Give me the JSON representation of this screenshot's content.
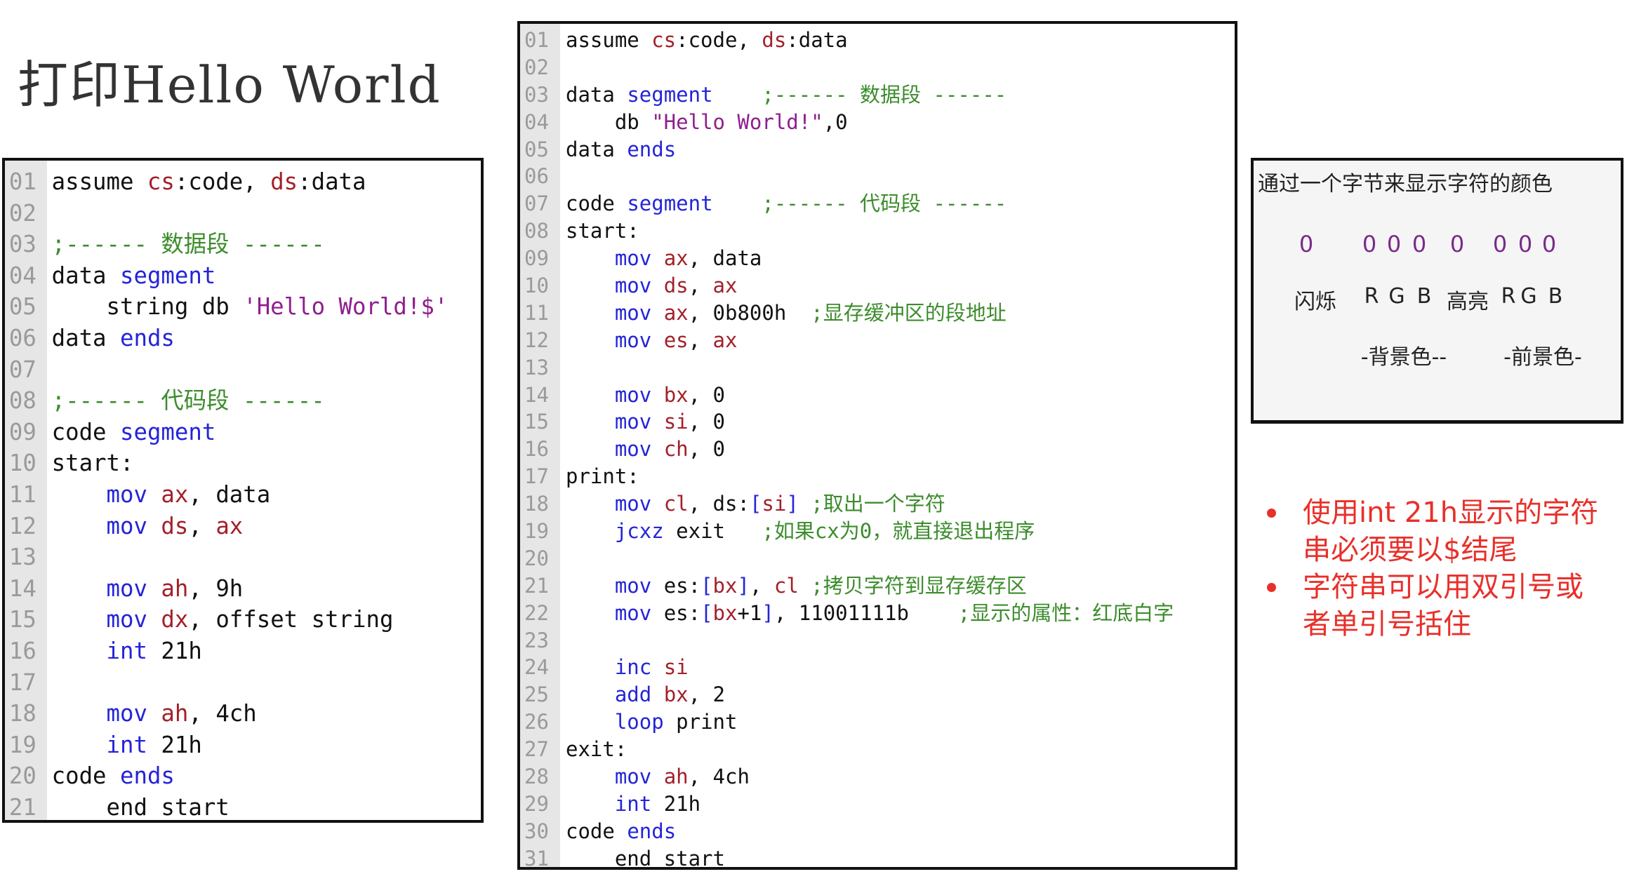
{
  "title": "打印Hello World",
  "colors": {
    "keyword": "#2424d8",
    "register": "#a3202a",
    "string": "#8e1f8e",
    "comment": "#3c8c2c",
    "note": "#e8302a",
    "bit": "#7a2a8a"
  },
  "left_code": [
    [
      [
        "assume ",
        "p"
      ],
      [
        "cs",
        "r"
      ],
      [
        ":code, ",
        "p"
      ],
      [
        "ds",
        "r"
      ],
      [
        ":data",
        "p"
      ]
    ],
    [],
    [
      [
        ";------ 数据段 ------",
        "c"
      ]
    ],
    [
      [
        "data ",
        "p"
      ],
      [
        "segment",
        "k"
      ]
    ],
    [
      [
        "    string db ",
        "p"
      ],
      [
        "'Hello World!$'",
        "s"
      ]
    ],
    [
      [
        "data ",
        "p"
      ],
      [
        "ends",
        "k"
      ]
    ],
    [],
    [
      [
        ";------ 代码段 ------",
        "c"
      ]
    ],
    [
      [
        "code ",
        "p"
      ],
      [
        "segment",
        "k"
      ]
    ],
    [
      [
        "start:",
        "p"
      ]
    ],
    [
      [
        "    ",
        "p"
      ],
      [
        "mov",
        "k"
      ],
      [
        " ",
        "p"
      ],
      [
        "ax",
        "r"
      ],
      [
        ", data",
        "p"
      ]
    ],
    [
      [
        "    ",
        "p"
      ],
      [
        "mov",
        "k"
      ],
      [
        " ",
        "p"
      ],
      [
        "ds",
        "r"
      ],
      [
        ", ",
        "p"
      ],
      [
        "ax",
        "r"
      ]
    ],
    [],
    [
      [
        "    ",
        "p"
      ],
      [
        "mov",
        "k"
      ],
      [
        " ",
        "p"
      ],
      [
        "ah",
        "r"
      ],
      [
        ", 9h",
        "p"
      ]
    ],
    [
      [
        "    ",
        "p"
      ],
      [
        "mov",
        "k"
      ],
      [
        " ",
        "p"
      ],
      [
        "dx",
        "r"
      ],
      [
        ", offset string",
        "p"
      ]
    ],
    [
      [
        "    ",
        "p"
      ],
      [
        "int",
        "k"
      ],
      [
        " 21h",
        "p"
      ]
    ],
    [],
    [
      [
        "    ",
        "p"
      ],
      [
        "mov",
        "k"
      ],
      [
        " ",
        "p"
      ],
      [
        "ah",
        "r"
      ],
      [
        ", 4ch",
        "p"
      ]
    ],
    [
      [
        "    ",
        "p"
      ],
      [
        "int",
        "k"
      ],
      [
        " 21h",
        "p"
      ]
    ],
    [
      [
        "code ",
        "p"
      ],
      [
        "ends",
        "k"
      ]
    ],
    [
      [
        "    end start",
        "p"
      ]
    ]
  ],
  "mid_code": [
    [
      [
        "assume ",
        "p"
      ],
      [
        "cs",
        "r"
      ],
      [
        ":code, ",
        "p"
      ],
      [
        "ds",
        "r"
      ],
      [
        ":data",
        "p"
      ]
    ],
    [],
    [
      [
        "data ",
        "p"
      ],
      [
        "segment",
        "k"
      ],
      [
        "    ;------ 数据段 ------",
        "c"
      ]
    ],
    [
      [
        "    db ",
        "p"
      ],
      [
        "\"Hello World!\"",
        "s"
      ],
      [
        ",0",
        "p"
      ]
    ],
    [
      [
        "data ",
        "p"
      ],
      [
        "ends",
        "k"
      ]
    ],
    [],
    [
      [
        "code ",
        "p"
      ],
      [
        "segment",
        "k"
      ],
      [
        "    ;------ 代码段 ------",
        "c"
      ]
    ],
    [
      [
        "start:",
        "p"
      ]
    ],
    [
      [
        "    ",
        "p"
      ],
      [
        "mov",
        "k"
      ],
      [
        " ",
        "p"
      ],
      [
        "ax",
        "r"
      ],
      [
        ", data",
        "p"
      ]
    ],
    [
      [
        "    ",
        "p"
      ],
      [
        "mov",
        "k"
      ],
      [
        " ",
        "p"
      ],
      [
        "ds",
        "r"
      ],
      [
        ", ",
        "p"
      ],
      [
        "ax",
        "r"
      ]
    ],
    [
      [
        "    ",
        "p"
      ],
      [
        "mov",
        "k"
      ],
      [
        " ",
        "p"
      ],
      [
        "ax",
        "r"
      ],
      [
        ", 0b800h  ",
        "p"
      ],
      [
        ";显存缓冲区的段地址",
        "c"
      ]
    ],
    [
      [
        "    ",
        "p"
      ],
      [
        "mov",
        "k"
      ],
      [
        " ",
        "p"
      ],
      [
        "es",
        "r"
      ],
      [
        ", ",
        "p"
      ],
      [
        "ax",
        "r"
      ]
    ],
    [],
    [
      [
        "    ",
        "p"
      ],
      [
        "mov",
        "k"
      ],
      [
        " ",
        "p"
      ],
      [
        "bx",
        "r"
      ],
      [
        ", 0",
        "p"
      ]
    ],
    [
      [
        "    ",
        "p"
      ],
      [
        "mov",
        "k"
      ],
      [
        " ",
        "p"
      ],
      [
        "si",
        "r"
      ],
      [
        ", 0",
        "p"
      ]
    ],
    [
      [
        "    ",
        "p"
      ],
      [
        "mov",
        "k"
      ],
      [
        " ",
        "p"
      ],
      [
        "ch",
        "r"
      ],
      [
        ", 0",
        "p"
      ]
    ],
    [
      [
        "print:",
        "p"
      ]
    ],
    [
      [
        "    ",
        "p"
      ],
      [
        "mov",
        "k"
      ],
      [
        " ",
        "p"
      ],
      [
        "cl",
        "r"
      ],
      [
        ", ds:",
        "p"
      ],
      [
        "[",
        "k"
      ],
      [
        "si",
        "r"
      ],
      [
        "]",
        "k"
      ],
      [
        " ",
        "p"
      ],
      [
        ";取出一个字符",
        "c"
      ]
    ],
    [
      [
        "    ",
        "p"
      ],
      [
        "jcxz",
        "k"
      ],
      [
        " exit   ",
        "p"
      ],
      [
        ";如果cx为0，就直接退出程序",
        "c"
      ]
    ],
    [],
    [
      [
        "    ",
        "p"
      ],
      [
        "mov",
        "k"
      ],
      [
        " es:",
        "p"
      ],
      [
        "[",
        "k"
      ],
      [
        "bx",
        "r"
      ],
      [
        "]",
        "k"
      ],
      [
        ", ",
        "p"
      ],
      [
        "cl",
        "r"
      ],
      [
        " ",
        "p"
      ],
      [
        ";拷贝字符到显存缓存区",
        "c"
      ]
    ],
    [
      [
        "    ",
        "p"
      ],
      [
        "mov",
        "k"
      ],
      [
        " es:",
        "p"
      ],
      [
        "[",
        "k"
      ],
      [
        "bx",
        "r"
      ],
      [
        "+1",
        "p"
      ],
      [
        "]",
        "k"
      ],
      [
        ", 11001111b    ",
        "p"
      ],
      [
        ";显示的属性：红底白字",
        "c"
      ]
    ],
    [],
    [
      [
        "    ",
        "p"
      ],
      [
        "inc",
        "k"
      ],
      [
        " ",
        "p"
      ],
      [
        "si",
        "r"
      ]
    ],
    [
      [
        "    ",
        "p"
      ],
      [
        "add",
        "k"
      ],
      [
        " ",
        "p"
      ],
      [
        "bx",
        "r"
      ],
      [
        ", 2",
        "p"
      ]
    ],
    [
      [
        "    ",
        "p"
      ],
      [
        "loop",
        "k"
      ],
      [
        " print",
        "p"
      ]
    ],
    [
      [
        "exit:",
        "p"
      ]
    ],
    [
      [
        "    ",
        "p"
      ],
      [
        "mov",
        "k"
      ],
      [
        " ",
        "p"
      ],
      [
        "ah",
        "r"
      ],
      [
        ", 4ch",
        "p"
      ]
    ],
    [
      [
        "    ",
        "p"
      ],
      [
        "int",
        "k"
      ],
      [
        " 21h",
        "p"
      ]
    ],
    [
      [
        "code ",
        "p"
      ],
      [
        "ends",
        "k"
      ]
    ],
    [
      [
        "    ",
        "p"
      ],
      [
        "end start",
        "p"
      ]
    ]
  ],
  "attr_box": {
    "caption": "通过一个字节来显示字符的颜色",
    "bits": [
      "0",
      "0",
      "0",
      "0",
      "0",
      "0",
      "0",
      "0"
    ],
    "labels": [
      "闪烁",
      "R",
      "G",
      "B",
      "高亮",
      "R",
      "G",
      "B"
    ],
    "groups": [
      "-背景色--",
      "-前景色-"
    ]
  },
  "notes": [
    "使用int 21h显示的字符串必须要以$结尾",
    "字符串可以用双引号或者单引号括住"
  ]
}
